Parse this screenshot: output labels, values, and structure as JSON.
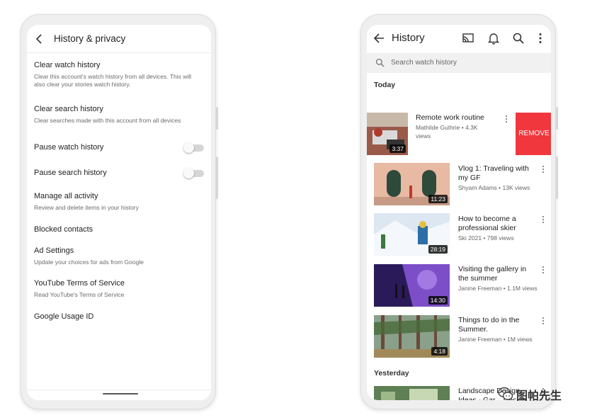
{
  "left_screen": {
    "title": "History & privacy",
    "settings": [
      {
        "title": "Clear watch history",
        "subtitle": "Clear this account's watch history from all devices. This will also clear your stories watch history."
      },
      {
        "title": "Clear search history",
        "subtitle": "Clear searches made with this account from all devices"
      },
      {
        "title": "Pause watch history",
        "subtitle": "",
        "toggle": false
      },
      {
        "title": "Pause search history",
        "subtitle": "",
        "toggle": false
      },
      {
        "title": "Manage all activity",
        "subtitle": "Review and delete items in your history"
      },
      {
        "title": "Blocked contacts",
        "subtitle": ""
      },
      {
        "title": "Ad Settings",
        "subtitle": "Update your choices for ads from Google"
      },
      {
        "title": "YouTube Terms of Service",
        "subtitle": "Read YouTube's Terms of Service"
      },
      {
        "title": "Google Usage ID",
        "subtitle": ""
      }
    ]
  },
  "right_screen": {
    "title": "History",
    "icons": [
      "cast-icon",
      "bell-icon",
      "search-icon",
      "more-vert-icon"
    ],
    "search_placeholder": "Search watch history",
    "sections": {
      "today": "Today",
      "yesterday": "Yesterday"
    },
    "remove_label": "REMOVE",
    "videos": [
      {
        "title": "Remote work routine",
        "channel": "Mathilde Guthrie • 4.3K",
        "meta2": "views",
        "duration": "3:37"
      },
      {
        "title": "Vlog 1: Traveling with my GF",
        "channel": "Shyam Adams • 13K views",
        "duration": "11:23"
      },
      {
        "title": "How to become a professional skier",
        "channel": "Ski 2021 • 798 views",
        "duration": "28:19"
      },
      {
        "title": "Visiting the gallery in the summer",
        "channel": "Janine Freeman • 1.1M views",
        "duration": "14:30"
      },
      {
        "title": "Things to do in the Summer.",
        "channel": "Janine Freeman • 1M views",
        "duration": "4:18"
      },
      {
        "title": "Landscape Design Ideas - Gar... Design for Small G...",
        "channel": "",
        "duration": ""
      }
    ]
  },
  "watermark": {
    "text": "图帕先生"
  },
  "colors": {
    "remove_red": "#f0373d",
    "frame_gray": "#efefef"
  }
}
